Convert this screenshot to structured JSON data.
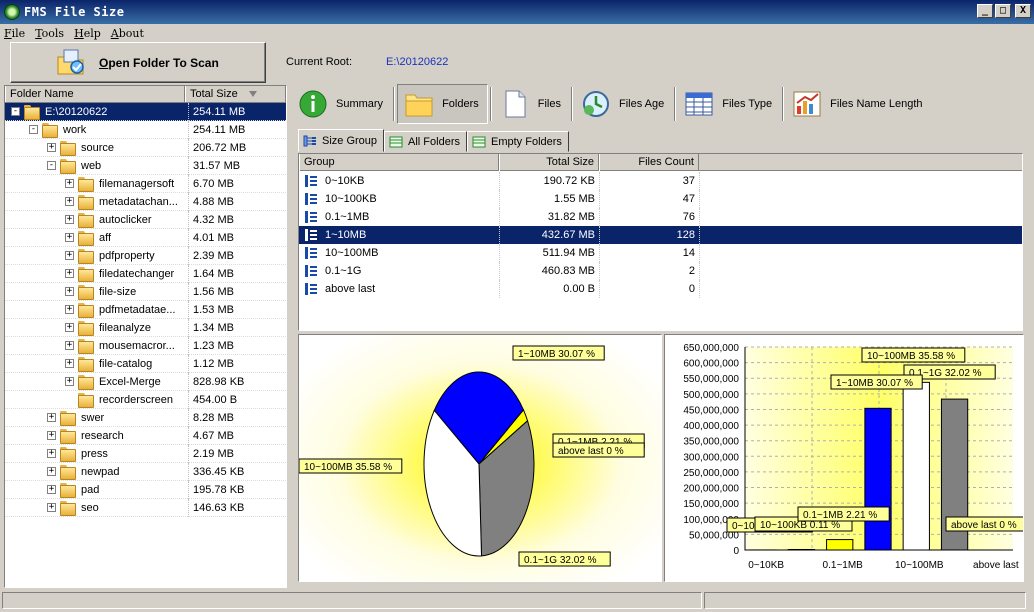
{
  "window": {
    "title": "FMS File Size",
    "min_label": "_",
    "max_label": "□",
    "close_label": "X"
  },
  "menu": [
    "File",
    "Tools",
    "Help",
    "About"
  ],
  "open_button": {
    "label": "Open Folder To Scan"
  },
  "current_root": {
    "label": "Current Root:",
    "value": "E:\\20120622"
  },
  "tree": {
    "headers": {
      "name": "Folder Name",
      "size": "Total Size"
    },
    "rows": [
      {
        "name": "E:\\20120622",
        "size": "254.11 MB",
        "level": 0,
        "exp": "-",
        "selected": true
      },
      {
        "name": "work",
        "size": "254.11 MB",
        "level": 1,
        "exp": "-"
      },
      {
        "name": "source",
        "size": "206.72 MB",
        "level": 2,
        "exp": "+"
      },
      {
        "name": "web",
        "size": "31.57 MB",
        "level": 2,
        "exp": "-"
      },
      {
        "name": "filemanagersoft",
        "size": "6.70 MB",
        "level": 3,
        "exp": "+"
      },
      {
        "name": "metadatachan...",
        "size": "4.88 MB",
        "level": 3,
        "exp": "+"
      },
      {
        "name": "autoclicker",
        "size": "4.32 MB",
        "level": 3,
        "exp": "+"
      },
      {
        "name": "aff",
        "size": "4.01 MB",
        "level": 3,
        "exp": "+"
      },
      {
        "name": "pdfproperty",
        "size": "2.39 MB",
        "level": 3,
        "exp": "+"
      },
      {
        "name": "filedatechanger",
        "size": "1.64 MB",
        "level": 3,
        "exp": "+"
      },
      {
        "name": "file-size",
        "size": "1.56 MB",
        "level": 3,
        "exp": "+"
      },
      {
        "name": "pdfmetadatae...",
        "size": "1.53 MB",
        "level": 3,
        "exp": "+"
      },
      {
        "name": "fileanalyze",
        "size": "1.34 MB",
        "level": 3,
        "exp": "+"
      },
      {
        "name": "mousemacror...",
        "size": "1.23 MB",
        "level": 3,
        "exp": "+"
      },
      {
        "name": "file-catalog",
        "size": "1.12 MB",
        "level": 3,
        "exp": "+"
      },
      {
        "name": "Excel-Merge",
        "size": "828.98 KB",
        "level": 3,
        "exp": "+"
      },
      {
        "name": "recorderscreen",
        "size": "454.00 B",
        "level": 3,
        "exp": ""
      },
      {
        "name": "swer",
        "size": "8.28 MB",
        "level": 2,
        "exp": "+"
      },
      {
        "name": "research",
        "size": "4.67 MB",
        "level": 2,
        "exp": "+"
      },
      {
        "name": "press",
        "size": "2.19 MB",
        "level": 2,
        "exp": "+"
      },
      {
        "name": "newpad",
        "size": "336.45 KB",
        "level": 2,
        "exp": "+"
      },
      {
        "name": "pad",
        "size": "195.78 KB",
        "level": 2,
        "exp": "+"
      },
      {
        "name": "seo",
        "size": "146.63 KB",
        "level": 2,
        "exp": "+"
      }
    ]
  },
  "toolbar": [
    {
      "label": "Summary",
      "icon": "info-icon"
    },
    {
      "label": "Folders",
      "icon": "folder-icon",
      "active": true
    },
    {
      "label": "Files",
      "icon": "file-icon"
    },
    {
      "label": "Files Age",
      "icon": "clock-icon"
    },
    {
      "label": "Files Type",
      "icon": "grid-icon"
    },
    {
      "label": "Files Name Length",
      "icon": "chart-icon"
    }
  ],
  "tabs": [
    {
      "label": "Size Group",
      "active": true
    },
    {
      "label": "All Folders"
    },
    {
      "label": "Empty Folders"
    }
  ],
  "grid": {
    "headers": {
      "group": "Group",
      "total": "Total Size",
      "count": "Files Count"
    },
    "rows": [
      {
        "group": "0~10KB",
        "total": "190.72 KB",
        "count": "37"
      },
      {
        "group": "10~100KB",
        "total": "1.55 MB",
        "count": "47"
      },
      {
        "group": "0.1~1MB",
        "total": "31.82 MB",
        "count": "76"
      },
      {
        "group": "1~10MB",
        "total": "432.67 MB",
        "count": "128",
        "selected": true
      },
      {
        "group": "10~100MB",
        "total": "511.94 MB",
        "count": "14"
      },
      {
        "group": "0.1~1G",
        "total": "460.83 MB",
        "count": "2"
      },
      {
        "group": "above last",
        "total": "0.00 B",
        "count": "0"
      }
    ]
  },
  "pie_labels": {
    "a": "1~10MB 30.07 %",
    "b": "0.1~1MB 2.21 %",
    "c": "above last 0 %",
    "d": "10~100MB 35.58 %",
    "e": "0.1~1G 32.02 %"
  },
  "bar_labels": {
    "ylabels": [
      "650,000,000",
      "600,000,000",
      "550,000,000",
      "500,000,000",
      "450,000,000",
      "400,000,000",
      "350,000,000",
      "300,000,000",
      "250,000,000",
      "200,000,000",
      "150,000,000",
      "100,000,000",
      "50,000,000",
      "0"
    ],
    "xlabels": [
      "0~10KB",
      "0.1~1MB",
      "10~100MB",
      "above last"
    ],
    "tags": {
      "t1": "10~100MB 35.58 %",
      "t2": "0.1~1G 32.02 %",
      "t3": "1~10MB 30.07 %",
      "t4": "0.1~1MB 2.21 %",
      "t5": "10~100KB 0.11 %",
      "t6": "0~10KB 0.01 %",
      "t7": "above last 0 %"
    }
  },
  "chart_data": [
    {
      "type": "pie",
      "categories": [
        "1~10MB",
        "0.1~1MB",
        "above last",
        "0.1~1G",
        "10~100MB"
      ],
      "values": [
        30.07,
        2.21,
        0,
        32.02,
        35.58
      ],
      "colors": [
        "#0000ff",
        "#ffff00",
        "#ff00ff",
        "#808080",
        "#ffffff"
      ]
    },
    {
      "type": "bar",
      "categories": [
        "0~10KB",
        "10~100KB",
        "0.1~1MB",
        "1~10MB",
        "10~100MB",
        "0.1~1G",
        "above last"
      ],
      "values": [
        199991,
        1625292,
        33365000,
        453686000,
        536810000,
        483211000,
        0
      ],
      "colors": [
        "#ff00ff",
        "#00ffff",
        "#ffff00",
        "#0000ff",
        "#ffffff",
        "#808080",
        "#000000"
      ],
      "ylim": [
        0,
        650000000
      ]
    }
  ]
}
